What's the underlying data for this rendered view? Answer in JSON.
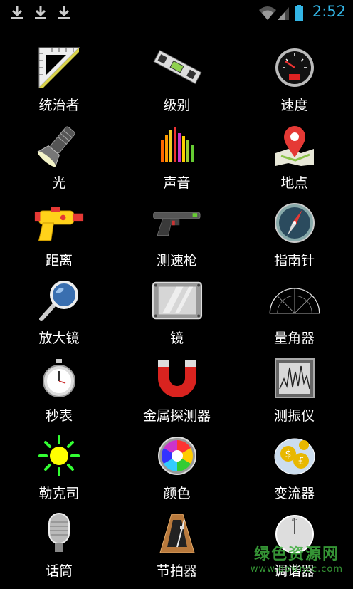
{
  "status_bar": {
    "time": "2:52",
    "notifications": [
      "download-icon",
      "download-icon",
      "download-icon"
    ],
    "accent_color": "#33b5e5"
  },
  "apps": [
    {
      "label": "统治者",
      "icon": "ruler-icon"
    },
    {
      "label": "级别",
      "icon": "spirit-level-icon"
    },
    {
      "label": "速度",
      "icon": "speedometer-icon"
    },
    {
      "label": "光",
      "icon": "flashlight-icon"
    },
    {
      "label": "声音",
      "icon": "sound-meter-icon"
    },
    {
      "label": "地点",
      "icon": "map-pin-icon"
    },
    {
      "label": "距离",
      "icon": "distance-gun-icon"
    },
    {
      "label": "测速枪",
      "icon": "speed-gun-icon"
    },
    {
      "label": "指南针",
      "icon": "compass-icon"
    },
    {
      "label": "放大镜",
      "icon": "magnifier-icon"
    },
    {
      "label": "镜",
      "icon": "mirror-icon"
    },
    {
      "label": "量角器",
      "icon": "protractor-icon"
    },
    {
      "label": "秒表",
      "icon": "stopwatch-icon"
    },
    {
      "label": "金属探测器",
      "icon": "magnet-icon"
    },
    {
      "label": "测振仪",
      "icon": "vibration-meter-icon"
    },
    {
      "label": "勒克司",
      "icon": "lux-sun-icon"
    },
    {
      "label": "颜色",
      "icon": "color-wheel-icon"
    },
    {
      "label": "变流器",
      "icon": "currency-converter-icon"
    },
    {
      "label": "话筒",
      "icon": "microphone-icon"
    },
    {
      "label": "节拍器",
      "icon": "metronome-icon"
    },
    {
      "label": "调谐器",
      "icon": "tuner-icon"
    }
  ],
  "watermark": {
    "main": "绿色资源网",
    "sub": "www.downcc.com"
  }
}
